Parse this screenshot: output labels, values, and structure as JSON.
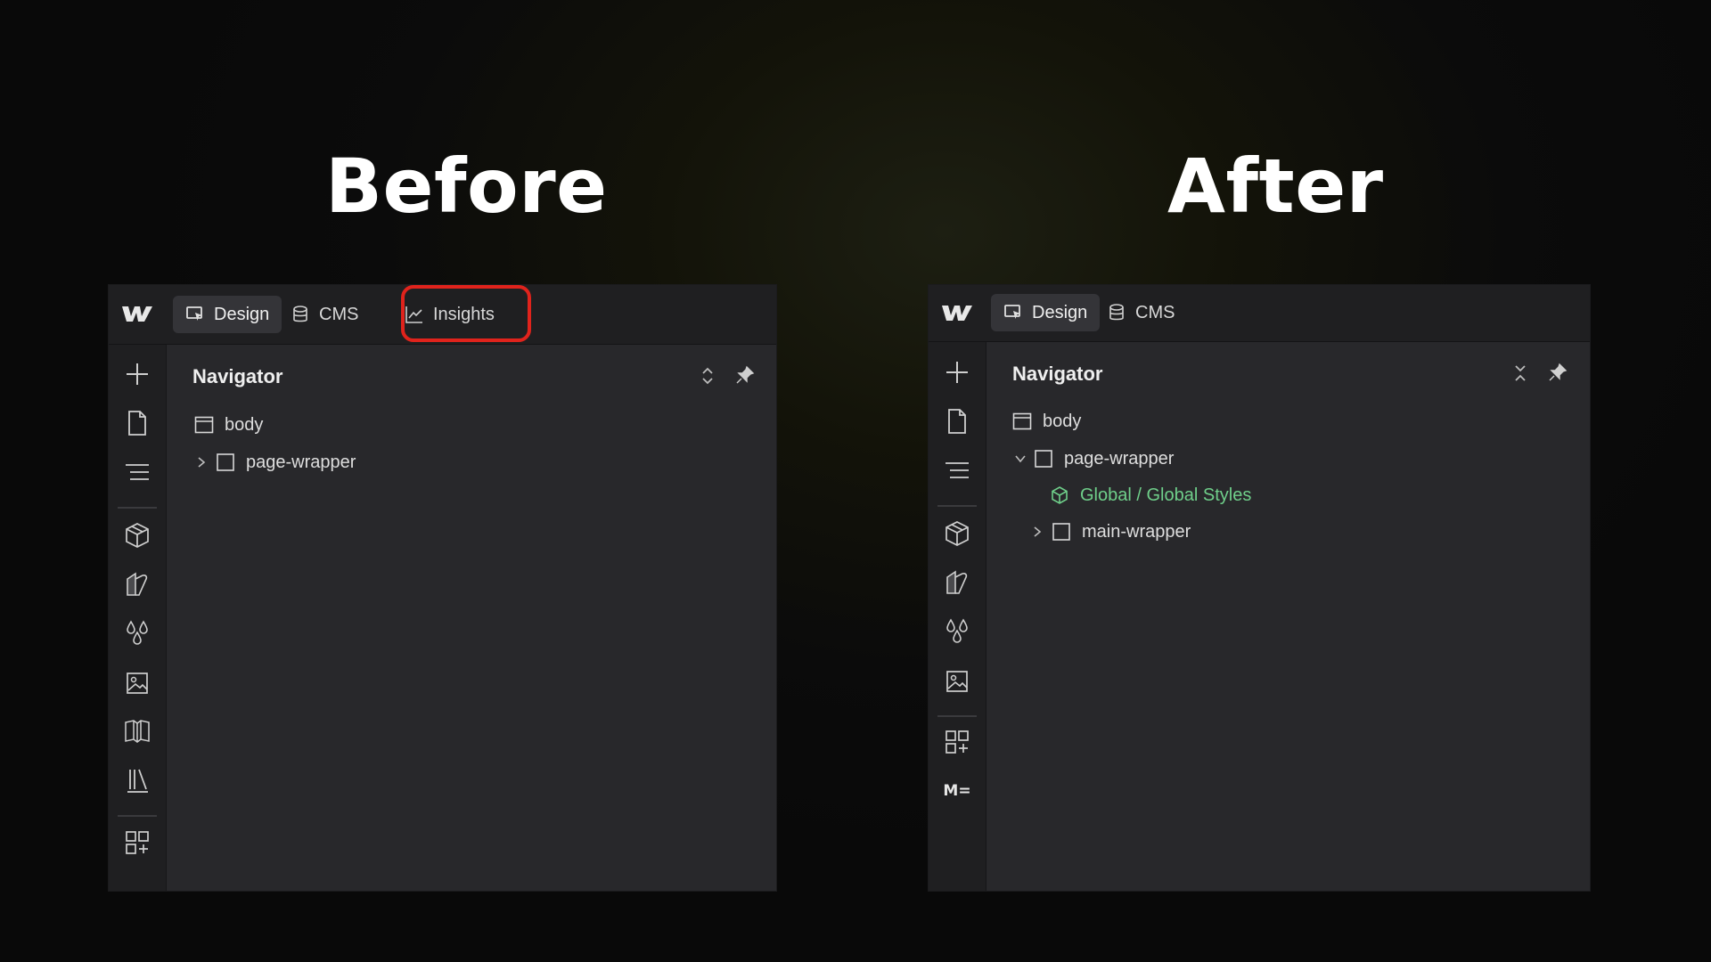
{
  "before": {
    "heading": "Before",
    "tabs": {
      "design": "Design",
      "cms": "CMS",
      "insights": "Insights"
    },
    "navigator": {
      "title": "Navigator",
      "tree": [
        {
          "label": "body",
          "icon": "body-frame-icon"
        },
        {
          "label": "page-wrapper",
          "icon": "box-icon",
          "expanded": false
        }
      ]
    },
    "rail_icons": [
      "add-icon",
      "page-icon",
      "navigator-icon",
      "components-icon",
      "styles-icon",
      "variables-icon",
      "assets-icon",
      "library-icon",
      "apps-library-icon",
      "apps-icon"
    ]
  },
  "after": {
    "heading": "After",
    "tabs": {
      "design": "Design",
      "cms": "CMS"
    },
    "navigator": {
      "title": "Navigator",
      "tree": [
        {
          "label": "body",
          "icon": "body-frame-icon"
        },
        {
          "label": "page-wrapper",
          "icon": "box-icon",
          "expanded": true
        },
        {
          "label": "Global / Global Styles",
          "icon": "component-icon"
        },
        {
          "label": "main-wrapper",
          "icon": "box-icon",
          "expanded": false
        }
      ]
    },
    "rail_icons": [
      "add-icon",
      "page-icon",
      "navigator-icon",
      "components-icon",
      "styles-icon",
      "variables-icon",
      "assets-icon",
      "apps-icon",
      "m-app-icon"
    ],
    "m_app_label": "M="
  },
  "colors": {
    "highlight": "#e0231c",
    "component_green": "#6fcf8a",
    "panel": "#28282b",
    "rail": "#1f1f21"
  }
}
